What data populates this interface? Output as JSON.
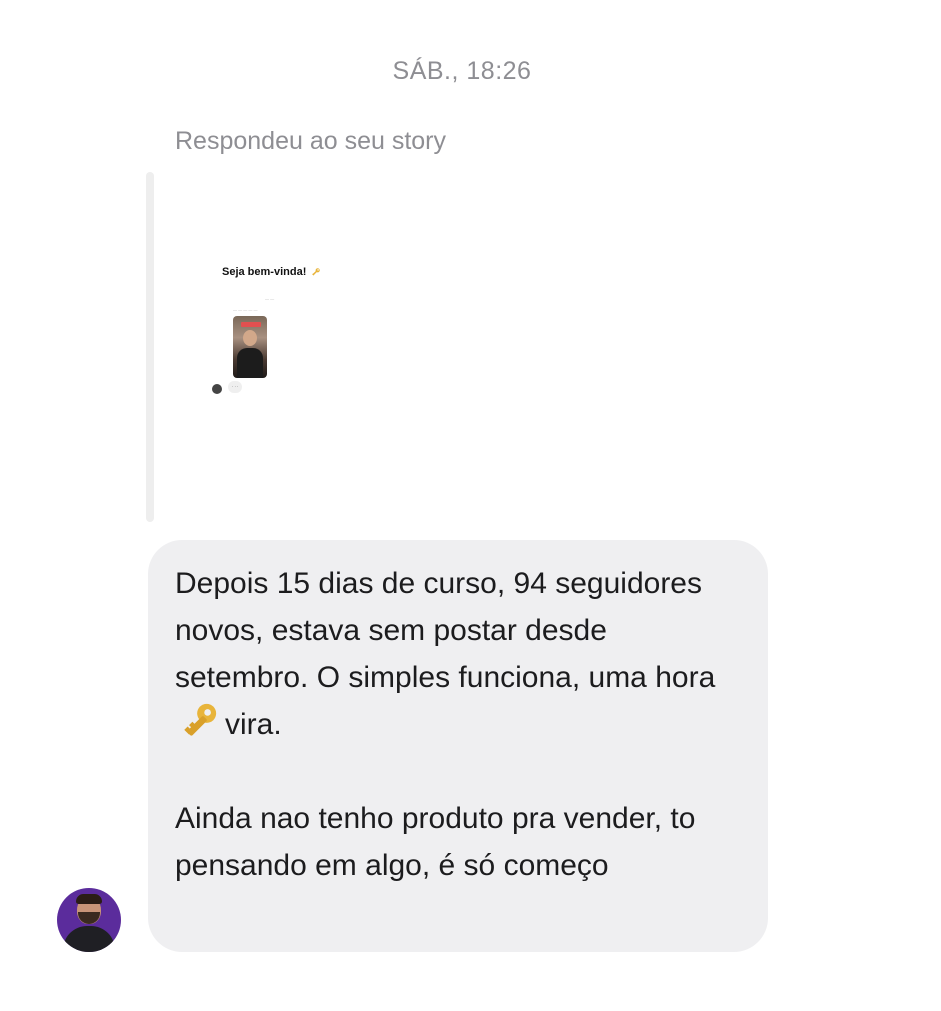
{
  "conversation": {
    "timestamp": "SÁB., 18:26"
  },
  "story_reply": {
    "label": "Respondeu ao seu story",
    "story_title": "Seja bem-vinda!",
    "story_title_icon": "key-icon"
  },
  "message": {
    "paragraph_1_before_icon": "Depois 15 dias de curso, 94 seguidores novos, estava sem postar desde setembro. O simples funciona, uma hora",
    "paragraph_1_icon": "key-icon",
    "paragraph_1_after_icon": "vira.",
    "paragraph_2": "Ainda nao tenho produto pra vender, to pensando em algo, é só começo"
  },
  "sender": {
    "avatar_icon": "profile-photo"
  },
  "colors": {
    "bubble_background": "#efeff1",
    "meta_text": "#8e8e93",
    "message_text": "#1c1c1e",
    "avatar_background": "#5b2c9c",
    "key_gold": "#e8b43a"
  }
}
